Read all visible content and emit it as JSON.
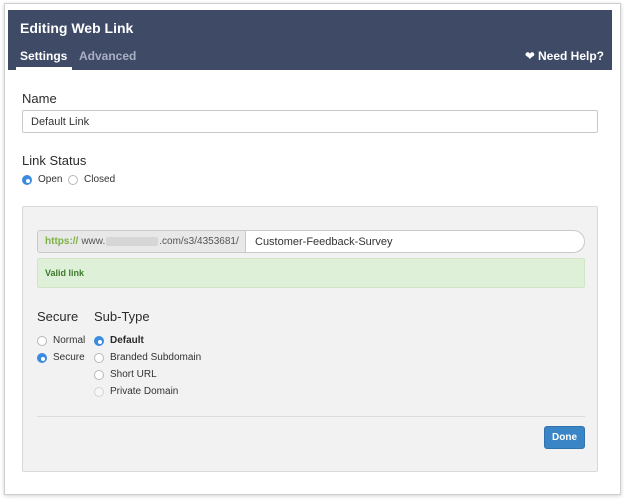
{
  "header": {
    "title": "Editing Web Link",
    "tabs": [
      {
        "label": "Settings",
        "active": true
      },
      {
        "label": "Advanced",
        "active": false
      }
    ],
    "help_label": "Need Help?",
    "help_icon": "heart-icon"
  },
  "name": {
    "label": "Name",
    "value": "Default Link"
  },
  "link_status": {
    "label": "Link Status",
    "options": [
      {
        "label": "Open",
        "selected": true
      },
      {
        "label": "Closed",
        "selected": false
      }
    ]
  },
  "url": {
    "scheme": "https://",
    "domain_start": "www.",
    "domain_end": ".com/s3/4353681/",
    "slug": "Customer-Feedback-Survey"
  },
  "validation": {
    "message": "Valid link"
  },
  "secure": {
    "label": "Secure",
    "options": [
      {
        "label": "Normal",
        "selected": false
      },
      {
        "label": "Secure",
        "selected": true
      }
    ]
  },
  "subtype": {
    "label": "Sub-Type",
    "options": [
      {
        "label": "Default",
        "selected": true
      },
      {
        "label": "Branded Subdomain",
        "selected": false
      },
      {
        "label": "Short URL",
        "selected": false
      },
      {
        "label": "Private Domain",
        "selected": false
      }
    ]
  },
  "actions": {
    "done_label": "Done"
  },
  "colors": {
    "header_bg": "#3e4a66",
    "accent_blue": "#3a85c6",
    "valid_bg": "#dff0d8",
    "valid_text": "#3c7a2b",
    "scheme_green": "#7bb342"
  }
}
